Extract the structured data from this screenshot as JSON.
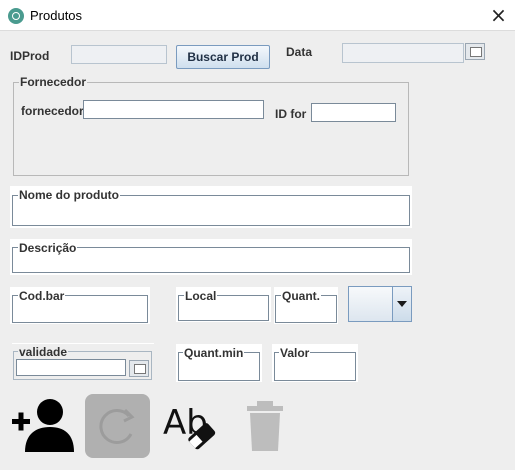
{
  "window": {
    "title": "Produtos",
    "close_label": "×"
  },
  "header": {
    "idprod_label": "IDProd",
    "idprod_value": "",
    "search_button_label": "Buscar Prod",
    "date_label": "Data",
    "date_value": ""
  },
  "fornecedor": {
    "group_title": "Fornecedor",
    "fornecedor_label": "fornecedor",
    "fornecedor_value": "",
    "id_label": "ID for",
    "id_value": ""
  },
  "product": {
    "name_label": "Nome do produto",
    "name_value": "",
    "description_label": "Descrição",
    "description_value": "",
    "barcode_label": "Cod.bar",
    "location_label": "Local",
    "quantity_label": "Quant.",
    "combo_selected": "",
    "validity_label": "validade",
    "validity_value": "",
    "min_quantity_label": "Quant.min",
    "value_label": "Valor"
  },
  "toolbar": {
    "add_icon": "add-user-icon",
    "refresh_icon": "refresh-icon",
    "spellcheck_icon": "spellcheck-eraser-icon",
    "delete_icon": "trash-icon",
    "spell_text": "Ab"
  },
  "colors": {
    "panel_bg": "#eeeeee",
    "field_border": "#7a8a99",
    "button_gradient_top": "#f4f8fc",
    "button_gradient_bottom": "#cfdfee",
    "refresh_bg": "#b0b0b0",
    "trash_gray": "#bdbdbd"
  }
}
